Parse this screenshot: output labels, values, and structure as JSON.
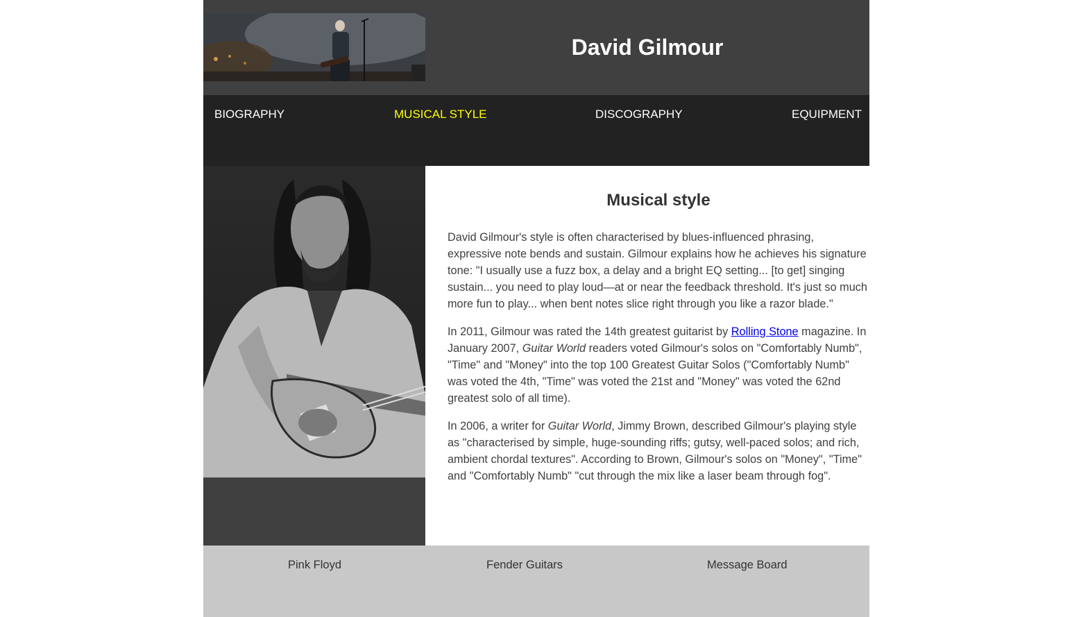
{
  "header": {
    "title": "David Gilmour",
    "banner_image": "David Gilmour performing on stage with guitar"
  },
  "nav": {
    "items": [
      {
        "label": "BIOGRAPHY",
        "active": false
      },
      {
        "label": "MUSICAL STYLE",
        "active": true
      },
      {
        "label": "DISCOGRAPHY",
        "active": false
      },
      {
        "label": "EQUIPMENT",
        "active": false
      }
    ]
  },
  "side": {
    "photo": "Black and white photo of David Gilmour playing a Stratocaster"
  },
  "main": {
    "heading": "Musical style",
    "p1": "David Gilmour's style is often characterised by blues-influenced phrasing, expressive note bends and sustain. Gilmour explains how he achieves his signature tone: \"I usually use a fuzz box, a delay and a bright EQ setting... [to get] singing sustain... you need to play loud—at or near the feedback threshold. It's just so much more fun to play... when bent notes slice right through you like a razor blade.\"",
    "p2": {
      "before_link": "In 2011, Gilmour was rated the 14th greatest guitarist by ",
      "link": "Rolling Stone",
      "after_link": " magazine. In January 2007, ",
      "italic": "Guitar World",
      "rest": " readers voted Gilmour's solos on \"Comfortably Numb\", \"Time\" and \"Money\" into the top 100 Greatest Guitar Solos (\"Comfortably Numb\" was voted the 4th, \"Time\" was voted the 21st and \"Money\" was voted the 62nd greatest solo of all time)."
    },
    "p3": {
      "before": "In 2006, a writer for ",
      "italic": "Guitar World",
      "rest": ", Jimmy Brown, described Gilmour's playing style as \"characterised by simple, huge-sounding riffs; gutsy, well-paced solos; and rich, ambient chordal textures\". According to Brown, Gilmour's solos on \"Money\", \"Time\" and \"Comfortably Numb\" \"cut through the mix like a laser beam through fog\"."
    }
  },
  "footer": {
    "links": [
      "Pink Floyd",
      "Fender Guitars",
      "Message Board"
    ]
  },
  "colors": {
    "header_bg": "#404040",
    "nav_bg": "#222222",
    "nav_active": "#ffff00",
    "footer_bg": "#c8c8c8",
    "link": "#0000ee"
  }
}
